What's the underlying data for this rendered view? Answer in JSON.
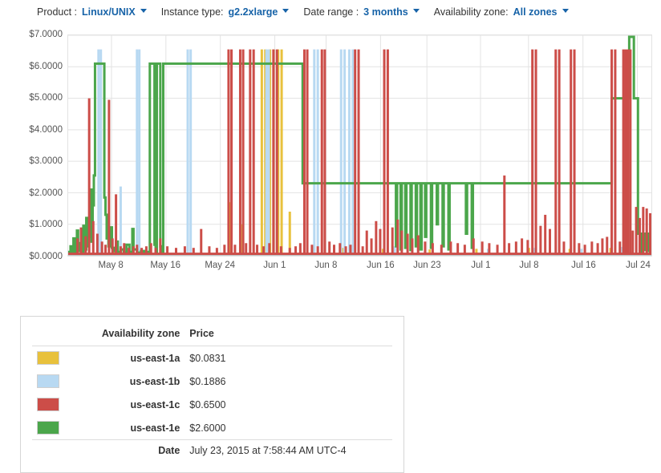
{
  "toolbar": {
    "filters": [
      {
        "label": "Product :",
        "value": "Linux/UNIX",
        "name": "product"
      },
      {
        "label": "Instance type:",
        "value": "g2.2xlarge",
        "name": "instance-type"
      },
      {
        "label": "Date range :",
        "value": "3 months",
        "name": "date-range"
      },
      {
        "label": "Availability zone:",
        "value": "All zones",
        "name": "availability-zone"
      }
    ]
  },
  "tooltip": {
    "col_zone": "Availability zone",
    "col_price": "Price",
    "rows": [
      {
        "zone": "us-east-1a",
        "price": "$0.0831",
        "color": "#e8c13c"
      },
      {
        "zone": "us-east-1b",
        "price": "$0.1886",
        "color": "#b8d9f2"
      },
      {
        "zone": "us-east-1c",
        "price": "$0.6500",
        "color": "#cc4d48"
      },
      {
        "zone": "us-east-1e",
        "price": "$2.6000",
        "color": "#4ba64b"
      }
    ],
    "date_label": "Date",
    "date_value": "July 23, 2015 at 7:58:44 AM UTC-4"
  },
  "chart_data": {
    "type": "line",
    "title": "",
    "xlabel": "",
    "ylabel": "",
    "ylim": [
      0,
      7
    ],
    "ytick_labels": [
      "$0.0000",
      "$1.0000",
      "$2.0000",
      "$3.0000",
      "$4.0000",
      "$5.0000",
      "$6.0000",
      "$7.0000"
    ],
    "ytick_values": [
      0,
      1,
      2,
      3,
      4,
      5,
      6,
      7
    ],
    "xtick_labels": [
      "May 8",
      "May 16",
      "May 24",
      "Jun 1",
      "Jun 8",
      "Jun 16",
      "Jun 23",
      "Jul 1",
      "Jul 8",
      "Jul 16",
      "Jul 24"
    ],
    "xtick_positions": [
      0.0743,
      0.1676,
      0.2609,
      0.3543,
      0.4422,
      0.5356,
      0.6151,
      0.707,
      0.7893,
      0.8827,
      0.976
    ],
    "grid": true,
    "legend_position": "external-tooltip",
    "colors": {
      "us-east-1a": "#e8c13c",
      "us-east-1b": "#b8d9f2",
      "us-east-1c": "#cc4d48",
      "us-east-1e": "#4ba64b",
      "gridline": "#e3e3e3",
      "axis_text": "#555555"
    },
    "series": [
      {
        "name": "us-east-1e",
        "color": "#4ba64b",
        "baseline": 0.05,
        "points": [
          [
            0.0,
            0.12
          ],
          [
            0.004,
            0.3
          ],
          [
            0.006,
            0.1
          ],
          [
            0.009,
            0.55
          ],
          [
            0.012,
            0.12
          ],
          [
            0.015,
            0.8
          ],
          [
            0.017,
            0.15
          ],
          [
            0.02,
            0.4
          ],
          [
            0.023,
            0.1
          ],
          [
            0.026,
            0.95
          ],
          [
            0.028,
            0.2
          ],
          [
            0.031,
            1.2
          ],
          [
            0.033,
            0.3
          ],
          [
            0.035,
            0.6
          ],
          [
            0.038,
            2.1
          ],
          [
            0.04,
            0.45
          ],
          [
            0.042,
            1.6
          ],
          [
            0.044,
            2.55
          ],
          [
            0.046,
            6.1
          ],
          [
            0.06,
            6.1
          ],
          [
            0.062,
            1.85
          ],
          [
            0.064,
            1.3
          ],
          [
            0.066,
            0.55
          ],
          [
            0.069,
            0.3
          ],
          [
            0.072,
            0.9
          ],
          [
            0.075,
            0.25
          ],
          [
            0.078,
            0.15
          ],
          [
            0.082,
            0.45
          ],
          [
            0.085,
            0.12
          ],
          [
            0.09,
            0.2
          ],
          [
            0.095,
            0.1
          ],
          [
            0.1,
            0.35
          ],
          [
            0.105,
            0.12
          ],
          [
            0.11,
            0.85
          ],
          [
            0.112,
            0.2
          ],
          [
            0.118,
            0.1
          ],
          [
            0.125,
            0.15
          ],
          [
            0.13,
            0.1
          ],
          [
            0.135,
            0.12
          ],
          [
            0.14,
            6.1
          ],
          [
            0.146,
            6.1
          ],
          [
            0.148,
            0.35
          ],
          [
            0.15,
            0.1
          ],
          [
            0.152,
            6.1
          ],
          [
            0.156,
            6.1
          ],
          [
            0.158,
            0.3
          ],
          [
            0.16,
            0.12
          ],
          [
            0.163,
            6.1
          ],
          [
            0.168,
            6.1
          ],
          [
            0.172,
            6.1
          ],
          [
            0.4,
            6.1
          ],
          [
            0.402,
            2.3
          ],
          [
            0.47,
            2.3
          ],
          [
            0.52,
            2.3
          ],
          [
            0.56,
            2.3
          ],
          [
            0.562,
            0.3
          ],
          [
            0.564,
            2.3
          ],
          [
            0.568,
            2.3
          ],
          [
            0.57,
            0.2
          ],
          [
            0.572,
            2.3
          ],
          [
            0.576,
            2.3
          ],
          [
            0.578,
            0.25
          ],
          [
            0.58,
            2.3
          ],
          [
            0.585,
            2.3
          ],
          [
            0.587,
            0.18
          ],
          [
            0.589,
            2.3
          ],
          [
            0.594,
            2.3
          ],
          [
            0.596,
            0.3
          ],
          [
            0.598,
            2.3
          ],
          [
            0.602,
            2.3
          ],
          [
            0.604,
            0.2
          ],
          [
            0.606,
            2.3
          ],
          [
            0.61,
            2.3
          ],
          [
            0.612,
            0.6
          ],
          [
            0.614,
            2.3
          ],
          [
            0.62,
            2.3
          ],
          [
            0.622,
            0.25
          ],
          [
            0.624,
            2.3
          ],
          [
            0.63,
            2.3
          ],
          [
            0.632,
            1.0
          ],
          [
            0.634,
            2.3
          ],
          [
            0.64,
            2.3
          ],
          [
            0.642,
            0.3
          ],
          [
            0.644,
            2.3
          ],
          [
            0.65,
            2.3
          ],
          [
            0.652,
            0.2
          ],
          [
            0.654,
            2.3
          ],
          [
            0.68,
            2.3
          ],
          [
            0.682,
            0.7
          ],
          [
            0.684,
            2.3
          ],
          [
            0.69,
            2.3
          ],
          [
            0.692,
            0.25
          ],
          [
            0.694,
            2.3
          ],
          [
            0.7,
            2.3
          ],
          [
            0.93,
            2.3
          ],
          [
            0.932,
            5.0
          ],
          [
            0.96,
            5.0
          ],
          [
            0.962,
            6.95
          ],
          [
            0.968,
            6.95
          ],
          [
            0.97,
            5.0
          ],
          [
            0.975,
            5.0
          ],
          [
            0.977,
            0.7
          ],
          [
            0.98,
            0.7
          ],
          [
            0.982,
            0.12
          ],
          [
            0.985,
            0.7
          ],
          [
            0.988,
            0.18
          ],
          [
            0.992,
            0.7
          ],
          [
            0.996,
            0.15
          ],
          [
            1.0,
            0.2
          ]
        ]
      },
      {
        "name": "us-east-1c",
        "color": "#cc4d48",
        "baseline": 0.06,
        "spikes": [
          [
            0.016,
            0.55
          ],
          [
            0.022,
            0.9
          ],
          [
            0.03,
            0.62
          ],
          [
            0.036,
            5.0
          ],
          [
            0.043,
            1.1
          ],
          [
            0.05,
            0.7
          ],
          [
            0.058,
            0.45
          ],
          [
            0.064,
            0.35
          ],
          [
            0.07,
            4.95
          ],
          [
            0.076,
            0.55
          ],
          [
            0.082,
            1.95
          ],
          [
            0.09,
            0.3
          ],
          [
            0.096,
            0.4
          ],
          [
            0.104,
            0.25
          ],
          [
            0.112,
            0.3
          ],
          [
            0.118,
            0.35
          ],
          [
            0.126,
            0.25
          ],
          [
            0.134,
            0.3
          ],
          [
            0.142,
            0.4
          ],
          [
            0.15,
            0.25
          ],
          [
            0.158,
            0.55
          ],
          [
            0.17,
            0.3
          ],
          [
            0.185,
            0.25
          ],
          [
            0.2,
            0.3
          ],
          [
            0.215,
            0.25
          ],
          [
            0.228,
            0.85
          ],
          [
            0.242,
            0.3
          ],
          [
            0.255,
            0.25
          ],
          [
            0.268,
            0.35
          ],
          [
            0.275,
            6.55
          ],
          [
            0.28,
            6.55
          ],
          [
            0.286,
            0.35
          ],
          [
            0.295,
            6.55
          ],
          [
            0.3,
            6.55
          ],
          [
            0.305,
            0.4
          ],
          [
            0.312,
            6.55
          ],
          [
            0.318,
            6.55
          ],
          [
            0.324,
            0.35
          ],
          [
            0.335,
            0.3
          ],
          [
            0.345,
            0.4
          ],
          [
            0.352,
            6.55
          ],
          [
            0.358,
            6.55
          ],
          [
            0.365,
            0.3
          ],
          [
            0.38,
            0.25
          ],
          [
            0.39,
            0.3
          ],
          [
            0.398,
            0.4
          ],
          [
            0.405,
            6.55
          ],
          [
            0.41,
            6.55
          ],
          [
            0.418,
            0.35
          ],
          [
            0.428,
            0.3
          ],
          [
            0.435,
            6.55
          ],
          [
            0.44,
            6.55
          ],
          [
            0.448,
            0.45
          ],
          [
            0.456,
            0.35
          ],
          [
            0.466,
            0.4
          ],
          [
            0.476,
            0.3
          ],
          [
            0.484,
            0.35
          ],
          [
            0.492,
            6.55
          ],
          [
            0.498,
            6.55
          ],
          [
            0.505,
            0.3
          ],
          [
            0.512,
            0.8
          ],
          [
            0.52,
            0.55
          ],
          [
            0.528,
            1.1
          ],
          [
            0.535,
            0.85
          ],
          [
            0.542,
            6.55
          ],
          [
            0.548,
            6.55
          ],
          [
            0.556,
            0.9
          ],
          [
            0.565,
            1.15
          ],
          [
            0.572,
            0.8
          ],
          [
            0.582,
            0.7
          ],
          [
            0.59,
            0.55
          ],
          [
            0.6,
            0.65
          ],
          [
            0.612,
            0.45
          ],
          [
            0.625,
            0.4
          ],
          [
            0.64,
            0.35
          ],
          [
            0.656,
            0.45
          ],
          [
            0.668,
            0.4
          ],
          [
            0.68,
            0.35
          ],
          [
            0.695,
            0.55
          ],
          [
            0.71,
            0.45
          ],
          [
            0.722,
            0.4
          ],
          [
            0.736,
            0.35
          ],
          [
            0.748,
            2.55
          ],
          [
            0.756,
            0.4
          ],
          [
            0.768,
            0.45
          ],
          [
            0.778,
            0.55
          ],
          [
            0.788,
            0.5
          ],
          [
            0.796,
            6.55
          ],
          [
            0.802,
            6.55
          ],
          [
            0.81,
            0.95
          ],
          [
            0.818,
            1.3
          ],
          [
            0.826,
            0.85
          ],
          [
            0.836,
            6.55
          ],
          [
            0.842,
            6.55
          ],
          [
            0.85,
            0.45
          ],
          [
            0.862,
            6.55
          ],
          [
            0.868,
            6.55
          ],
          [
            0.876,
            0.4
          ],
          [
            0.886,
            0.35
          ],
          [
            0.898,
            0.45
          ],
          [
            0.908,
            0.4
          ],
          [
            0.916,
            0.55
          ],
          [
            0.924,
            0.6
          ],
          [
            0.932,
            6.55
          ],
          [
            0.938,
            6.55
          ],
          [
            0.946,
            0.45
          ],
          [
            0.952,
            6.55
          ],
          [
            0.956,
            6.55
          ],
          [
            0.96,
            6.55
          ],
          [
            0.964,
            6.55
          ],
          [
            0.968,
            0.8
          ],
          [
            0.974,
            1.55
          ],
          [
            0.98,
            1.2
          ],
          [
            0.986,
            1.55
          ],
          [
            0.992,
            1.5
          ],
          [
            0.998,
            1.35
          ]
        ]
      },
      {
        "name": "us-east-1b",
        "color": "#b8d9f2",
        "baseline": 0.04,
        "spikes": [
          [
            0.052,
            6.55
          ],
          [
            0.056,
            6.55
          ],
          [
            0.09,
            2.2
          ],
          [
            0.118,
            6.55
          ],
          [
            0.122,
            6.55
          ],
          [
            0.205,
            6.55
          ],
          [
            0.21,
            6.55
          ],
          [
            0.295,
            6.2
          ],
          [
            0.34,
            6.55
          ],
          [
            0.344,
            6.55
          ],
          [
            0.422,
            6.55
          ],
          [
            0.428,
            6.55
          ],
          [
            0.468,
            6.55
          ],
          [
            0.474,
            6.55
          ],
          [
            0.482,
            6.55
          ],
          [
            0.488,
            6.55
          ],
          [
            0.56,
            0.3
          ],
          [
            0.64,
            0.25
          ],
          [
            0.72,
            0.22
          ],
          [
            0.8,
            0.25
          ],
          [
            0.88,
            0.22
          ],
          [
            0.95,
            0.28
          ]
        ]
      },
      {
        "name": "us-east-1a",
        "color": "#e8c13c",
        "baseline": 0.03,
        "spikes": [
          [
            0.08,
            0.25
          ],
          [
            0.15,
            0.2
          ],
          [
            0.276,
            1.7
          ],
          [
            0.296,
            1.0
          ],
          [
            0.332,
            6.55
          ],
          [
            0.338,
            6.55
          ],
          [
            0.346,
            6.55
          ],
          [
            0.352,
            6.55
          ],
          [
            0.36,
            6.55
          ],
          [
            0.366,
            6.55
          ],
          [
            0.38,
            1.4
          ],
          [
            0.42,
            0.3
          ],
          [
            0.47,
            0.25
          ],
          [
            0.54,
            0.22
          ],
          [
            0.62,
            0.2
          ],
          [
            0.7,
            0.22
          ],
          [
            0.79,
            0.25
          ],
          [
            0.86,
            0.22
          ],
          [
            0.93,
            0.25
          ]
        ]
      }
    ]
  }
}
